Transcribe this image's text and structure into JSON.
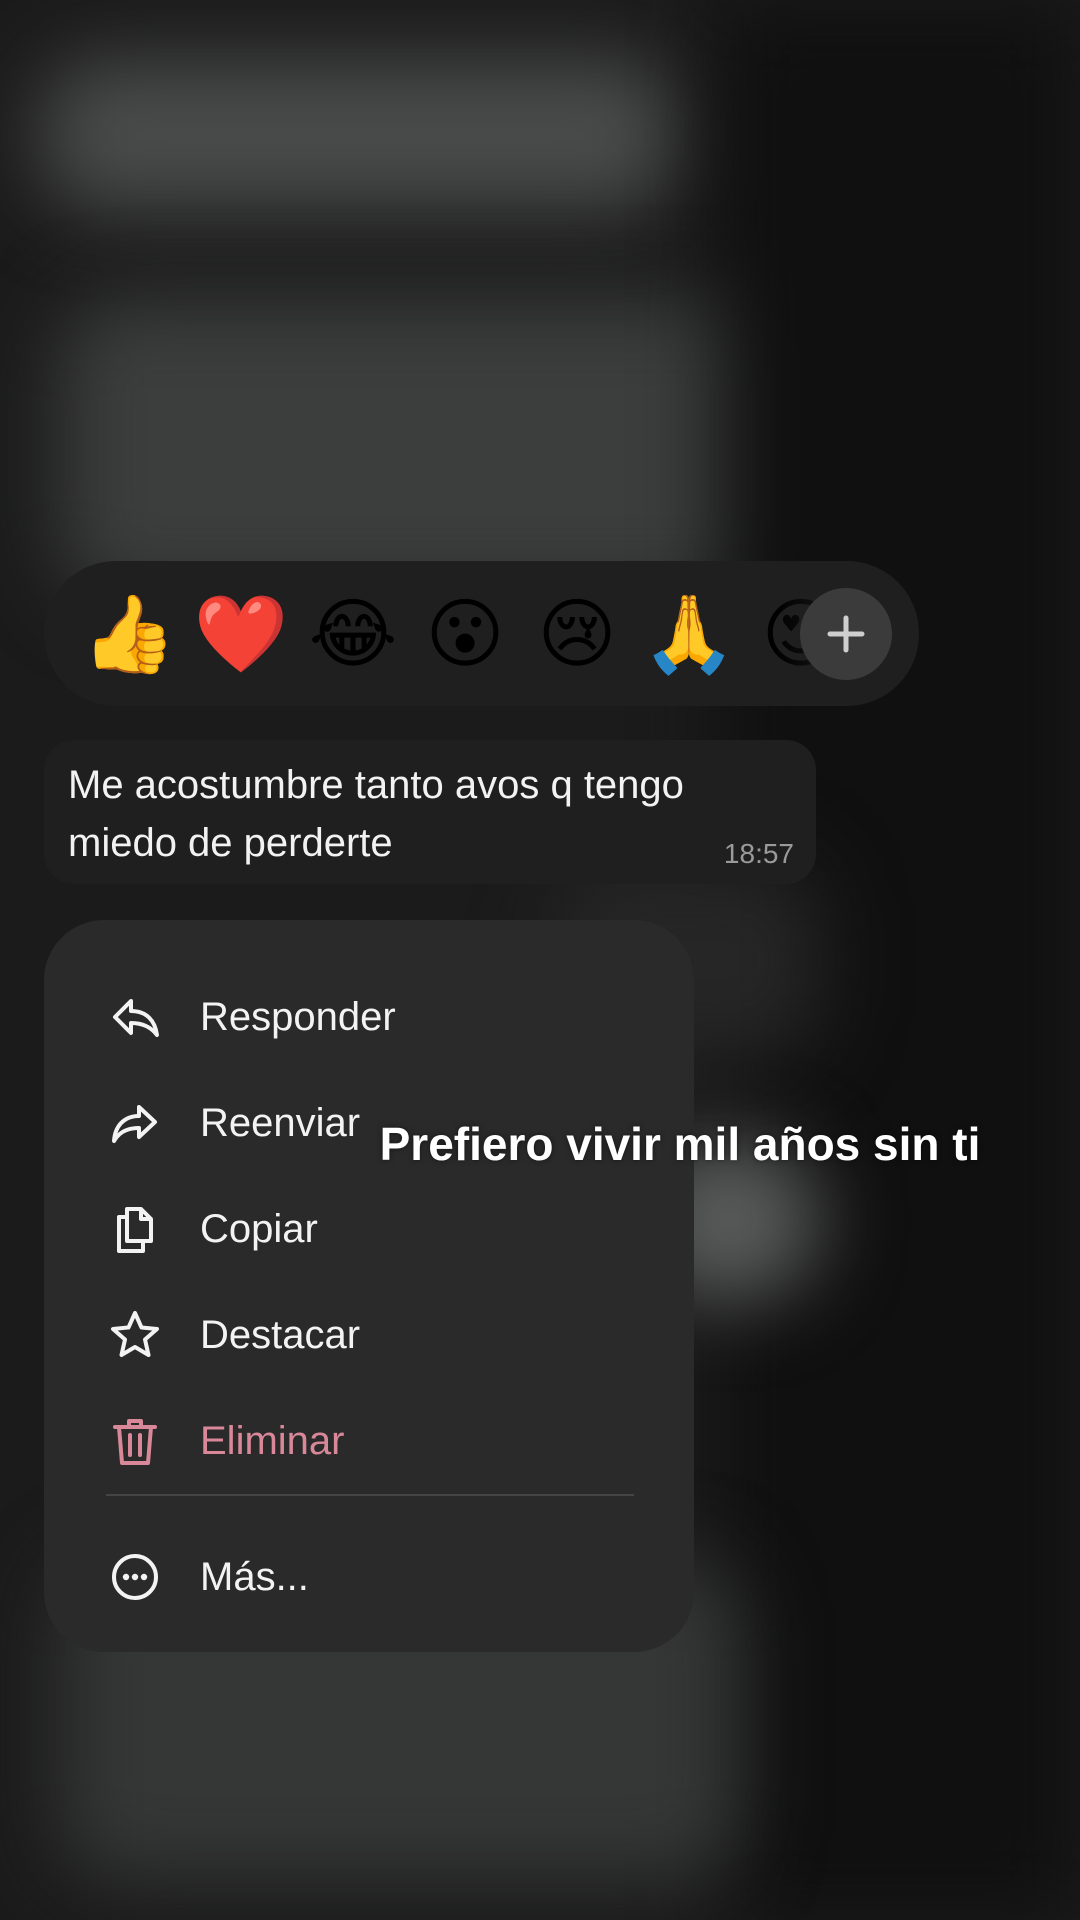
{
  "reactions": {
    "emojis": [
      {
        "name": "thumbs-up",
        "glyph": "👍"
      },
      {
        "name": "red-heart",
        "glyph": "❤️"
      },
      {
        "name": "tears-of-joy",
        "glyph": "😂"
      },
      {
        "name": "surprised-face",
        "glyph": "😮"
      },
      {
        "name": "crying-face",
        "glyph": "😢"
      },
      {
        "name": "folded-hands",
        "glyph": "🙏"
      },
      {
        "name": "heart-eyes-face",
        "glyph": "😍"
      }
    ],
    "more_icon": "plus-icon"
  },
  "message": {
    "text": "Me acostumbre tanto avos q tengo miedo de perderte",
    "time": "18:57"
  },
  "menu": {
    "items": [
      {
        "label": "Responder",
        "icon": "reply-icon"
      },
      {
        "label": "Reenviar",
        "icon": "forward-icon"
      },
      {
        "label": "Copiar",
        "icon": "copy-icon"
      },
      {
        "label": "Destacar",
        "icon": "star-icon"
      },
      {
        "label": "Eliminar",
        "icon": "trash-icon",
        "color": "#d9889a"
      },
      {
        "label": "Más...",
        "icon": "more-circle-icon"
      }
    ]
  },
  "overlay": {
    "caption": "Prefiero vivir mil años sin ti"
  }
}
